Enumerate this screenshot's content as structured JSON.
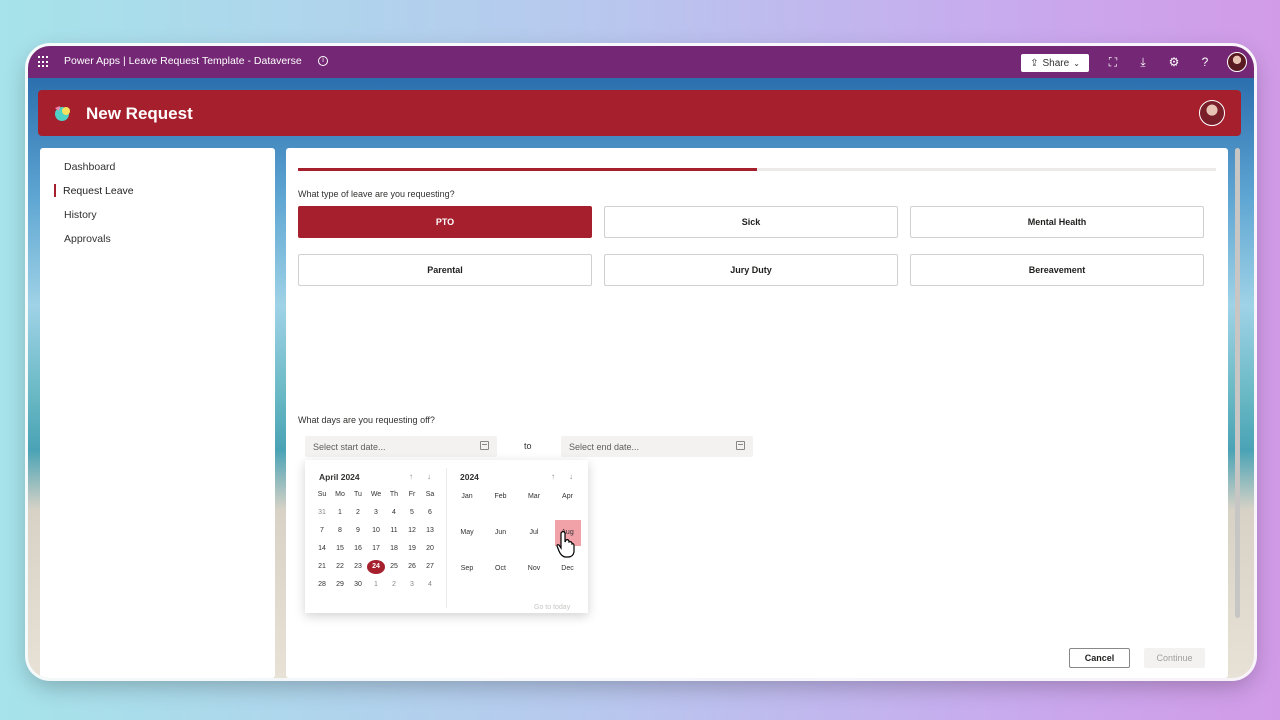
{
  "topbar": {
    "title": "Power Apps  |  Leave Request Template - Dataverse",
    "share_label": "Share",
    "icons": [
      "waffle-icon",
      "info-icon",
      "fullscreen-icon",
      "download-icon",
      "gear-icon",
      "help-icon"
    ],
    "help_glyph": "?"
  },
  "header": {
    "title": "New Request",
    "brand_color": "#a51f2d"
  },
  "sidebar": {
    "items": [
      {
        "label": "Dashboard"
      },
      {
        "label": "Request Leave",
        "active": true
      },
      {
        "label": "History"
      },
      {
        "label": "Approvals"
      }
    ]
  },
  "form": {
    "progress": 0.5,
    "leave_question": "What type of leave are you requesting?",
    "leave_types": [
      {
        "label": "PTO",
        "selected": true
      },
      {
        "label": "Sick"
      },
      {
        "label": "Mental Health"
      },
      {
        "label": "Parental"
      },
      {
        "label": "Jury Duty"
      },
      {
        "label": "Bereavement"
      }
    ],
    "days_question": "What days are you requesting off?",
    "start_placeholder": "Select start date...",
    "to_label": "to",
    "end_placeholder": "Select end date..."
  },
  "calendar": {
    "month_label": "April 2024",
    "weekdays": [
      "Su",
      "Mo",
      "Tu",
      "We",
      "Th",
      "Fr",
      "Sa"
    ],
    "weeks": [
      [
        "31",
        "1",
        "2",
        "3",
        "4",
        "5",
        "6"
      ],
      [
        "7",
        "8",
        "9",
        "10",
        "11",
        "12",
        "13"
      ],
      [
        "14",
        "15",
        "16",
        "17",
        "18",
        "19",
        "20"
      ],
      [
        "21",
        "22",
        "23",
        "24",
        "25",
        "26",
        "27"
      ],
      [
        "28",
        "29",
        "30",
        "1",
        "2",
        "3",
        "4"
      ]
    ],
    "today": "24",
    "year_label": "2024",
    "months": [
      "Jan",
      "Feb",
      "Mar",
      "Apr",
      "May",
      "Jun",
      "Jul",
      "Aug",
      "Sep",
      "Oct",
      "Nov",
      "Dec"
    ],
    "hovered_month": "Aug",
    "go_to_today": "Go to today",
    "up_arrow": "↑",
    "down_arrow": "↓"
  },
  "actions": {
    "cancel_label": "Cancel",
    "continue_label": "Continue"
  }
}
